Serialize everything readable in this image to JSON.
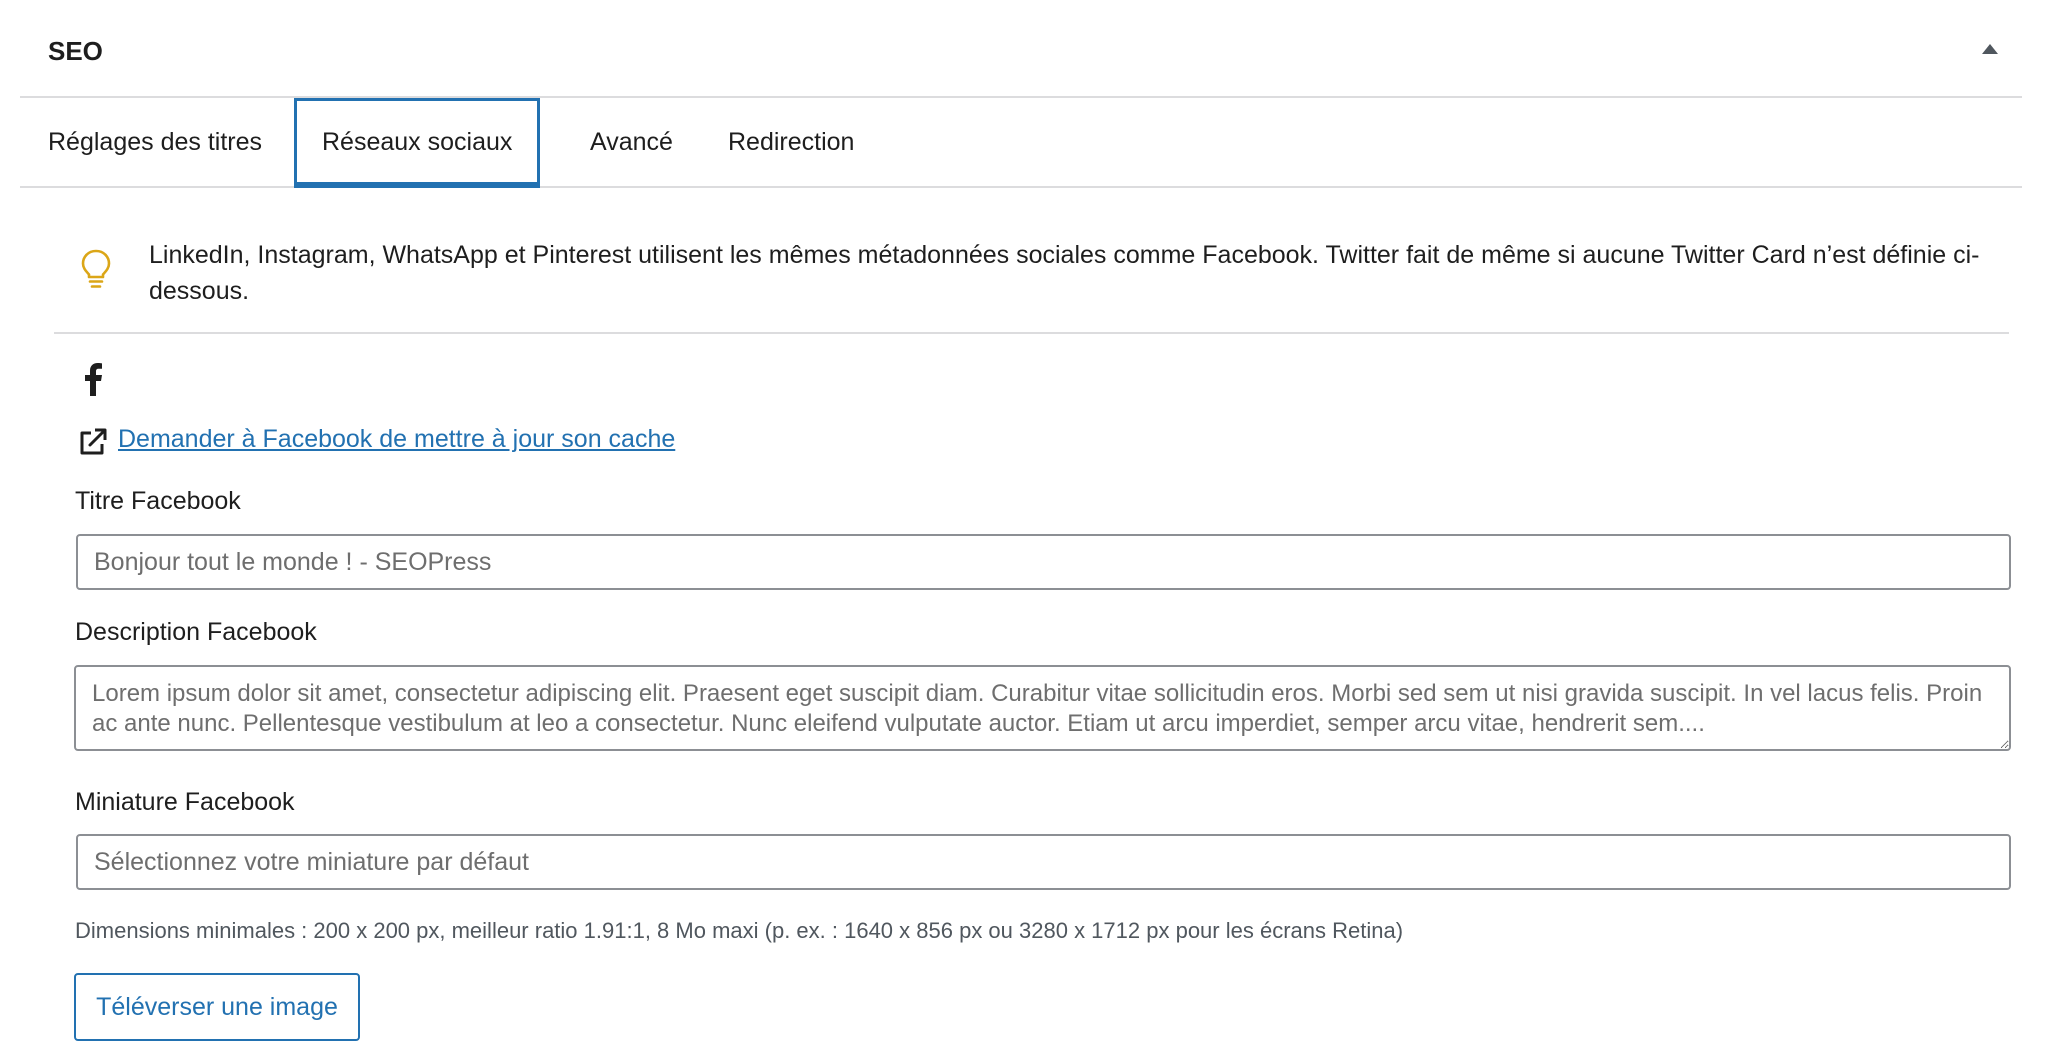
{
  "panel": {
    "title": "SEO",
    "collapse_icon": "caret-up-icon"
  },
  "tabs": [
    {
      "label": "Réglages des titres",
      "active": false
    },
    {
      "label": "Réseaux sociaux",
      "active": true
    },
    {
      "label": "Avancé",
      "active": false
    },
    {
      "label": "Redirection",
      "active": false
    }
  ],
  "notice": {
    "icon": "lightbulb-icon",
    "text": "LinkedIn, Instagram, WhatsApp et Pinterest utilisent les mêmes métadonnées sociales comme Facebook. Twitter fait de même si aucune Twitter Card n’est définie ci-dessous."
  },
  "facebook": {
    "icon": "facebook-icon",
    "cache_link": {
      "icon": "external-link-icon",
      "label": "Demander à Facebook de mettre à jour son cache"
    },
    "title_field": {
      "label": "Titre Facebook",
      "value": "",
      "placeholder": "Bonjour tout le monde ! - SEOPress"
    },
    "description_field": {
      "label": "Description Facebook",
      "value": "",
      "placeholder": "Lorem ipsum dolor sit amet, consectetur adipiscing elit. Praesent eget suscipit diam. Curabitur vitae sollicitudin eros. Morbi sed sem ut nisi gravida suscipit. In vel lacus felis. Proin ac ante nunc. Pellentesque vestibulum at leo a consectetur. Nunc eleifend vulputate auctor. Etiam ut arcu imperdiet, semper arcu vitae, hendrerit sem...."
    },
    "thumbnail_field": {
      "label": "Miniature Facebook",
      "value": "",
      "placeholder": "Sélectionnez votre miniature par défaut"
    },
    "help_text": "Dimensions minimales : 200 x 200 px, meilleur ratio 1.91:1, 8 Mo maxi (p. ex. : 1640 x 856 px ou 3280 x 1712 px pour les écrans Retina)",
    "upload_button_label": "Téléverser une image"
  },
  "colors": {
    "accent": "#2271b1",
    "lightbulb": "#dba617",
    "border": "#8c8f94",
    "divider": "#dcdcde"
  }
}
